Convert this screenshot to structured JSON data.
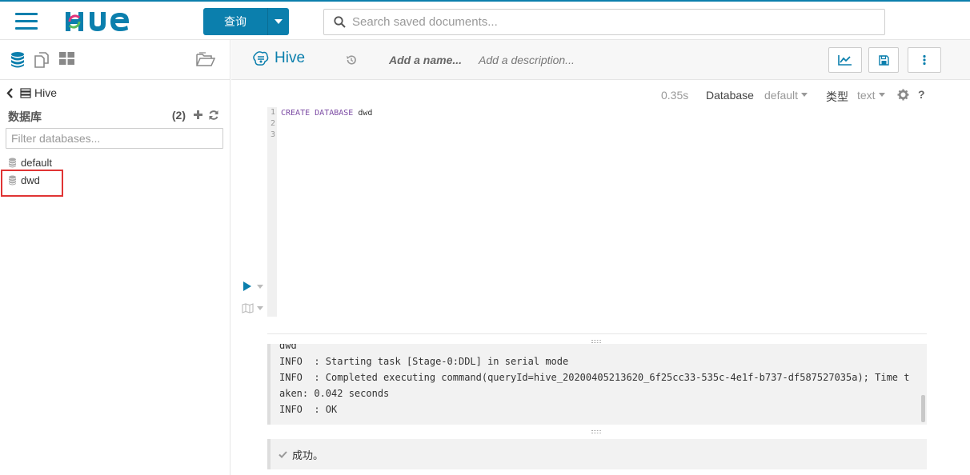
{
  "topbar": {
    "logo_text": "HUE",
    "query_label": "查询",
    "search_placeholder": "Search saved documents..."
  },
  "sidebar": {
    "breadcrumb": "Hive",
    "databases_heading": "数据库",
    "database_count": "(2)",
    "filter_placeholder": "Filter databases...",
    "databases": [
      "default",
      "dwd"
    ],
    "highlighted_database": "dwd"
  },
  "editor": {
    "engine": "Hive",
    "name_placeholder": "Add a name...",
    "description_placeholder": "Add a description...",
    "execution_time": "0.35s",
    "database_label": "Database",
    "database_value": "default",
    "type_label": "类型",
    "type_value": "text",
    "help_label": "?",
    "line_numbers": [
      "1",
      "2",
      "3"
    ],
    "code": {
      "keyword1": "CREATE",
      "keyword2": "DATABASE",
      "identifier": "dwd"
    }
  },
  "log": {
    "lines": [
      "dwd",
      "INFO  : Starting task [Stage-0:DDL] in serial mode",
      "INFO  : Completed executing command(queryId=hive_20200405213620_6f25cc33-535c-4e1f-b737-df587527035a); Time t",
      "aken: 0.042 seconds",
      "INFO  : OK"
    ]
  },
  "result": {
    "status_text": "成功。"
  },
  "colors": {
    "accent": "#0b7fad",
    "keyword": "#7b4aa3",
    "highlight_border": "#e03434"
  }
}
